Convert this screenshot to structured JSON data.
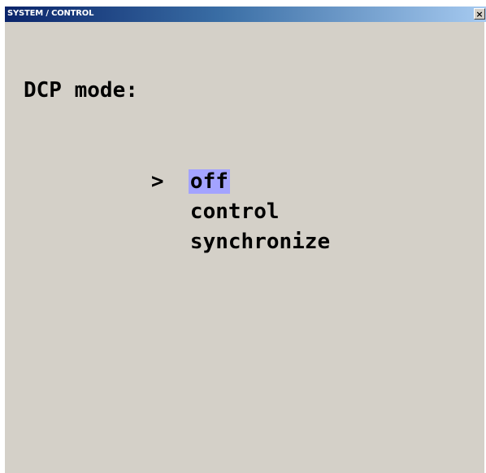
{
  "window": {
    "title": "SYSTEM / CONTROL",
    "close_symbol": "×"
  },
  "prompt": "DCP mode:",
  "menu": {
    "cursor": ">",
    "selected_index": 0,
    "items": [
      {
        "label": "off"
      },
      {
        "label": "control"
      },
      {
        "label": "synchronize"
      }
    ]
  },
  "colors": {
    "background": "#d4d0c8",
    "selection_highlight": "#a3a3ff",
    "titlebar_start": "#0a246a",
    "titlebar_end": "#a6caf0"
  }
}
